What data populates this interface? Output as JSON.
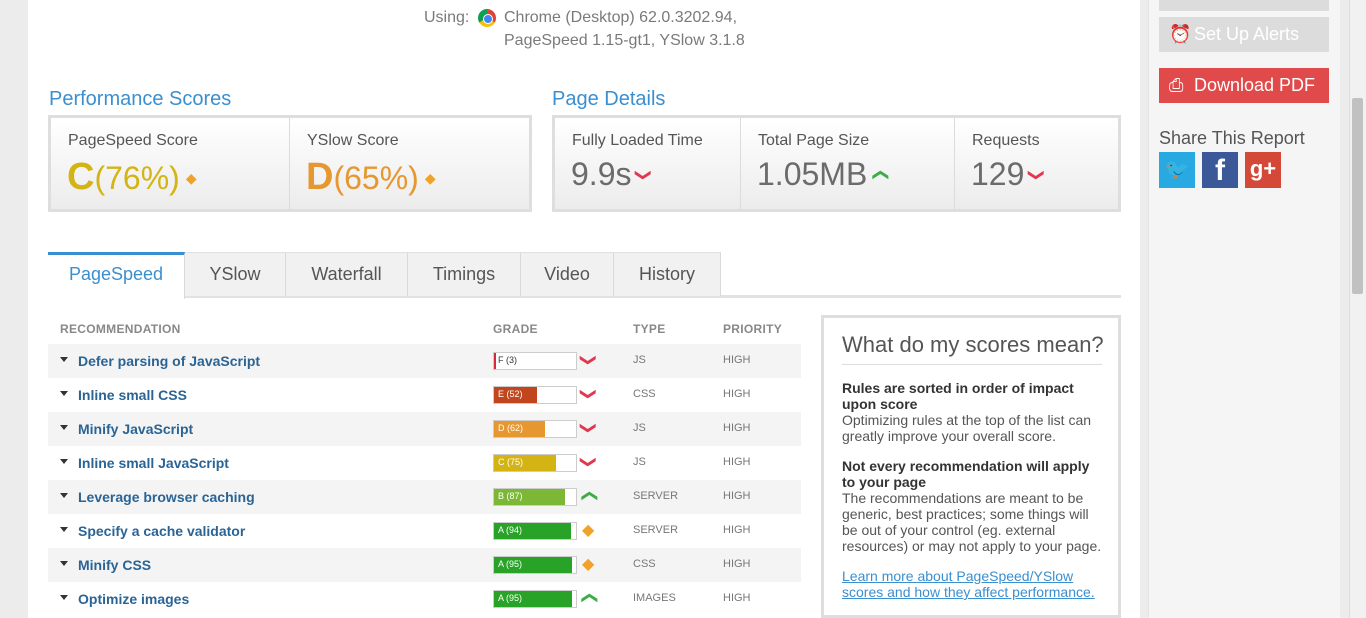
{
  "using": {
    "label": "Using:",
    "browser": "Chrome (Desktop) 62.0.3202.94,",
    "tools": "PageSpeed 1.15-gt1, YSlow 3.1.8",
    "browser_icon": "chrome-icon"
  },
  "performance": {
    "title": "Performance Scores",
    "pagespeed": {
      "label": "PageSpeed Score",
      "letter": "C",
      "percent": "(76%)",
      "trend": "diamond"
    },
    "yslow": {
      "label": "YSlow Score",
      "letter": "D",
      "percent": "(65%)",
      "trend": "diamond"
    }
  },
  "details": {
    "title": "Page Details",
    "loaded": {
      "label": "Fully Loaded Time",
      "value": "9.9s",
      "trend": "down"
    },
    "size": {
      "label": "Total Page Size",
      "value": "1.05MB",
      "trend": "up"
    },
    "requests": {
      "label": "Requests",
      "value": "129",
      "trend": "down"
    }
  },
  "tabs": [
    "PageSpeed",
    "YSlow",
    "Waterfall",
    "Timings",
    "Video",
    "History"
  ],
  "table": {
    "headers": {
      "rec": "RECOMMENDATION",
      "grade": "GRADE",
      "type": "TYPE",
      "priority": "PRIORITY"
    },
    "rows": [
      {
        "name": "Defer parsing of JavaScript",
        "grade": "F (3)",
        "score": 3,
        "color": "#d9283a",
        "trend": "down",
        "type": "JS",
        "priority": "HIGH"
      },
      {
        "name": "Inline small CSS",
        "grade": "E (52)",
        "score": 52,
        "color": "#c1461e",
        "trend": "down",
        "type": "CSS",
        "priority": "HIGH"
      },
      {
        "name": "Minify JavaScript",
        "grade": "D (62)",
        "score": 62,
        "color": "#e6972f",
        "trend": "down",
        "type": "JS",
        "priority": "HIGH"
      },
      {
        "name": "Inline small JavaScript",
        "grade": "C (75)",
        "score": 75,
        "color": "#d4b415",
        "trend": "down",
        "type": "JS",
        "priority": "HIGH"
      },
      {
        "name": "Leverage browser caching",
        "grade": "B (87)",
        "score": 87,
        "color": "#7cb836",
        "trend": "up",
        "type": "SERVER",
        "priority": "HIGH"
      },
      {
        "name": "Specify a cache validator",
        "grade": "A (94)",
        "score": 94,
        "color": "#28a328",
        "trend": "diamond",
        "type": "SERVER",
        "priority": "HIGH"
      },
      {
        "name": "Minify CSS",
        "grade": "A (95)",
        "score": 95,
        "color": "#28a328",
        "trend": "diamond",
        "type": "CSS",
        "priority": "HIGH"
      },
      {
        "name": "Optimize images",
        "grade": "A (95)",
        "score": 95,
        "color": "#28a328",
        "trend": "up",
        "type": "IMAGES",
        "priority": "HIGH"
      }
    ]
  },
  "info": {
    "title": "What do my scores mean?",
    "b1": "Rules are sorted in order of impact upon score",
    "p1": "Optimizing rules at the top of the list can greatly improve your overall score.",
    "b2": "Not every recommendation will apply to your page",
    "p2": "The recommendations are meant to be generic, best practices; some things will be out of your control (eg. external resources) or may not apply to your page.",
    "link": "Learn more about PageSpeed/YSlow scores and how they affect performance."
  },
  "sidebar": {
    "alerts": "Set Up Alerts",
    "alerts_icon": "alarm-clock-icon",
    "pdf": "Download PDF",
    "pdf_icon": "pdf-icon",
    "share_title": "Share This Report",
    "social": [
      "twitter-icon",
      "facebook-icon",
      "google-plus-icon"
    ]
  },
  "colors": {
    "accent": "#3a8fd0",
    "red": "#e04a4a",
    "up": "#3dab47",
    "down": "#e0384f",
    "neutral": "#f0a229"
  }
}
